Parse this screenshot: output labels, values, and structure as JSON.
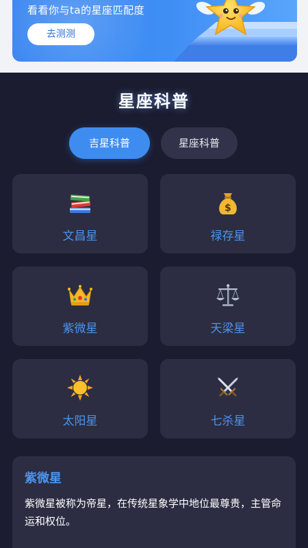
{
  "banner": {
    "subtitle": "看看你与ta的星座匹配度",
    "button_label": "去测测",
    "mascot_icon": "star-mascot-icon",
    "colors": {
      "start": "#3a86f0",
      "end": "#5aa5fb"
    }
  },
  "section": {
    "title": "星座科普"
  },
  "tabs": [
    {
      "label": "吉星科普",
      "active": true
    },
    {
      "label": "星座科普",
      "active": false
    }
  ],
  "stars": [
    {
      "label": "文昌星",
      "icon": "books-icon"
    },
    {
      "label": "禄存星",
      "icon": "money-bag-icon"
    },
    {
      "label": "紫微星",
      "icon": "crown-icon"
    },
    {
      "label": "天梁星",
      "icon": "scales-icon"
    },
    {
      "label": "太阳星",
      "icon": "sun-icon"
    },
    {
      "label": "七杀星",
      "icon": "crossed-swords-icon"
    }
  ],
  "detail": {
    "title": "紫微星",
    "text": "紫微星被称为帝星，在传统星象学中地位最尊贵，主管命运和权位。"
  },
  "colors": {
    "accent": "#3e8cf0",
    "background": "#1b1c30",
    "card": "#2c2d42",
    "label": "#4d93ec"
  }
}
